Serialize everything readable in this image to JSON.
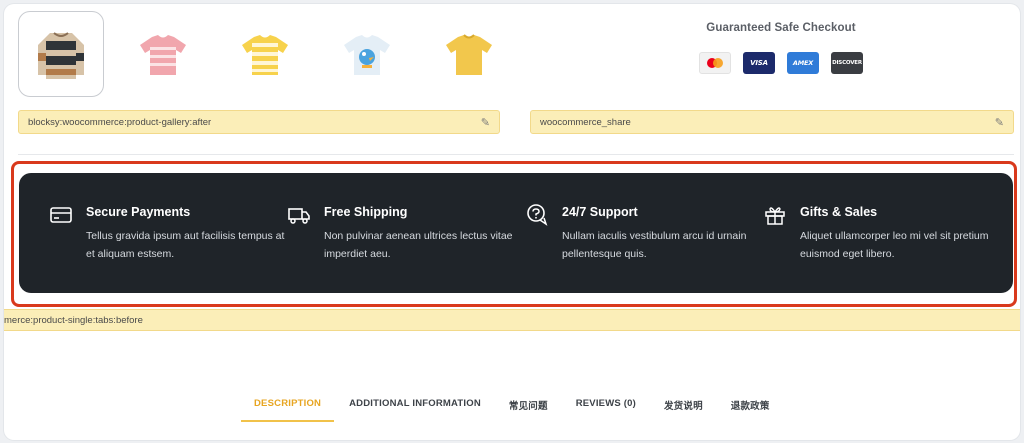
{
  "gallery": {
    "thumbnails": [
      {
        "name": "striped-sweater",
        "active": true
      },
      {
        "name": "pink-striped-tshirt",
        "active": false
      },
      {
        "name": "yellow-striped-tshirt",
        "active": false
      },
      {
        "name": "bird-print-tshirt",
        "active": false
      },
      {
        "name": "yellow-tshirt",
        "active": false
      }
    ]
  },
  "checkout": {
    "title": "Guaranteed Safe Checkout",
    "cards": [
      "mastercard",
      "VISA",
      "AMEX",
      "DISCOVER"
    ]
  },
  "hooks": {
    "gallery_after": "blocksy:woocommerce:product-gallery:after",
    "share": "woocommerce_share",
    "tabs_before": "merce:product-single:tabs:before"
  },
  "features": [
    {
      "icon": "credit-card-icon",
      "title": "Secure Payments",
      "desc": "Tellus gravida ipsum aut facilisis tempus at et aliquam estsem."
    },
    {
      "icon": "truck-icon",
      "title": "Free Shipping",
      "desc": "Non pulvinar aenean ultrices lectus vitae imperdiet aeu."
    },
    {
      "icon": "support-chat-icon",
      "title": "24/7 Support",
      "desc": "Nullam iaculis vestibulum arcu id urnain pellentesque quis."
    },
    {
      "icon": "gift-icon",
      "title": "Gifts & Sales",
      "desc": "Aliquet ullamcorper leo mi vel sit pretium euismod eget libero."
    }
  ],
  "tabs": [
    {
      "label": "DESCRIPTION",
      "active": true
    },
    {
      "label": "ADDITIONAL INFORMATION",
      "active": false
    },
    {
      "label": "常见问题",
      "active": false
    },
    {
      "label": "REVIEWS (0)",
      "active": false
    },
    {
      "label": "发货说明",
      "active": false
    },
    {
      "label": "退款政策",
      "active": false
    }
  ],
  "colors": {
    "band": "#1f2429",
    "highlight": "#d9391c",
    "hook": "#fbeeb8",
    "accent": "#e7a521"
  }
}
